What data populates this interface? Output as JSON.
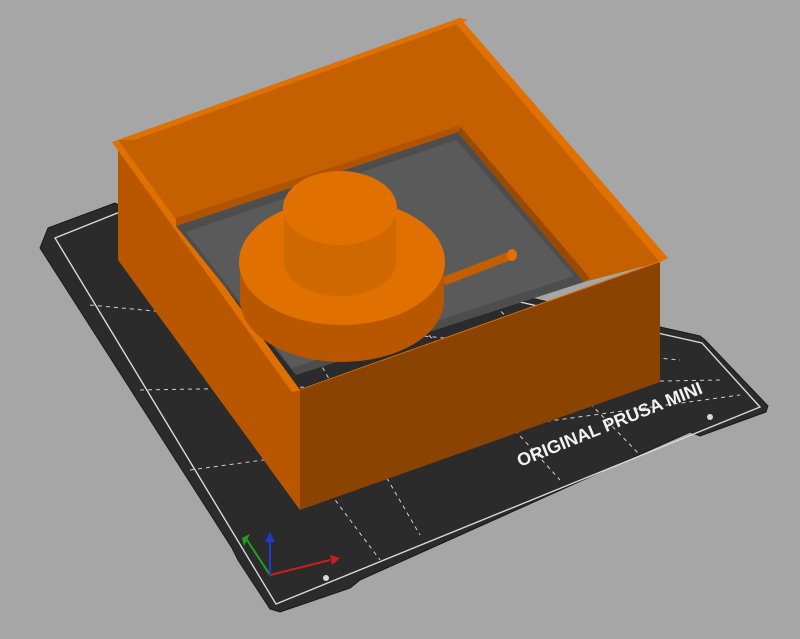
{
  "app": {
    "name": "3D plater viewport"
  },
  "bed": {
    "label": "ORIGINAL PRUSA MINI",
    "colors": {
      "background": "#a6a6a6",
      "plate": "#2d2d2d",
      "grid": "#d9d9d9",
      "label": "#f2f2f2"
    }
  },
  "model": {
    "color_top": "#e07000",
    "color_side": "#b85700",
    "color_dark": "#7a3a00"
  },
  "axes": {
    "x_color": "#c81e1e",
    "y_color": "#1fa31f",
    "z_color": "#1e3cc8"
  }
}
